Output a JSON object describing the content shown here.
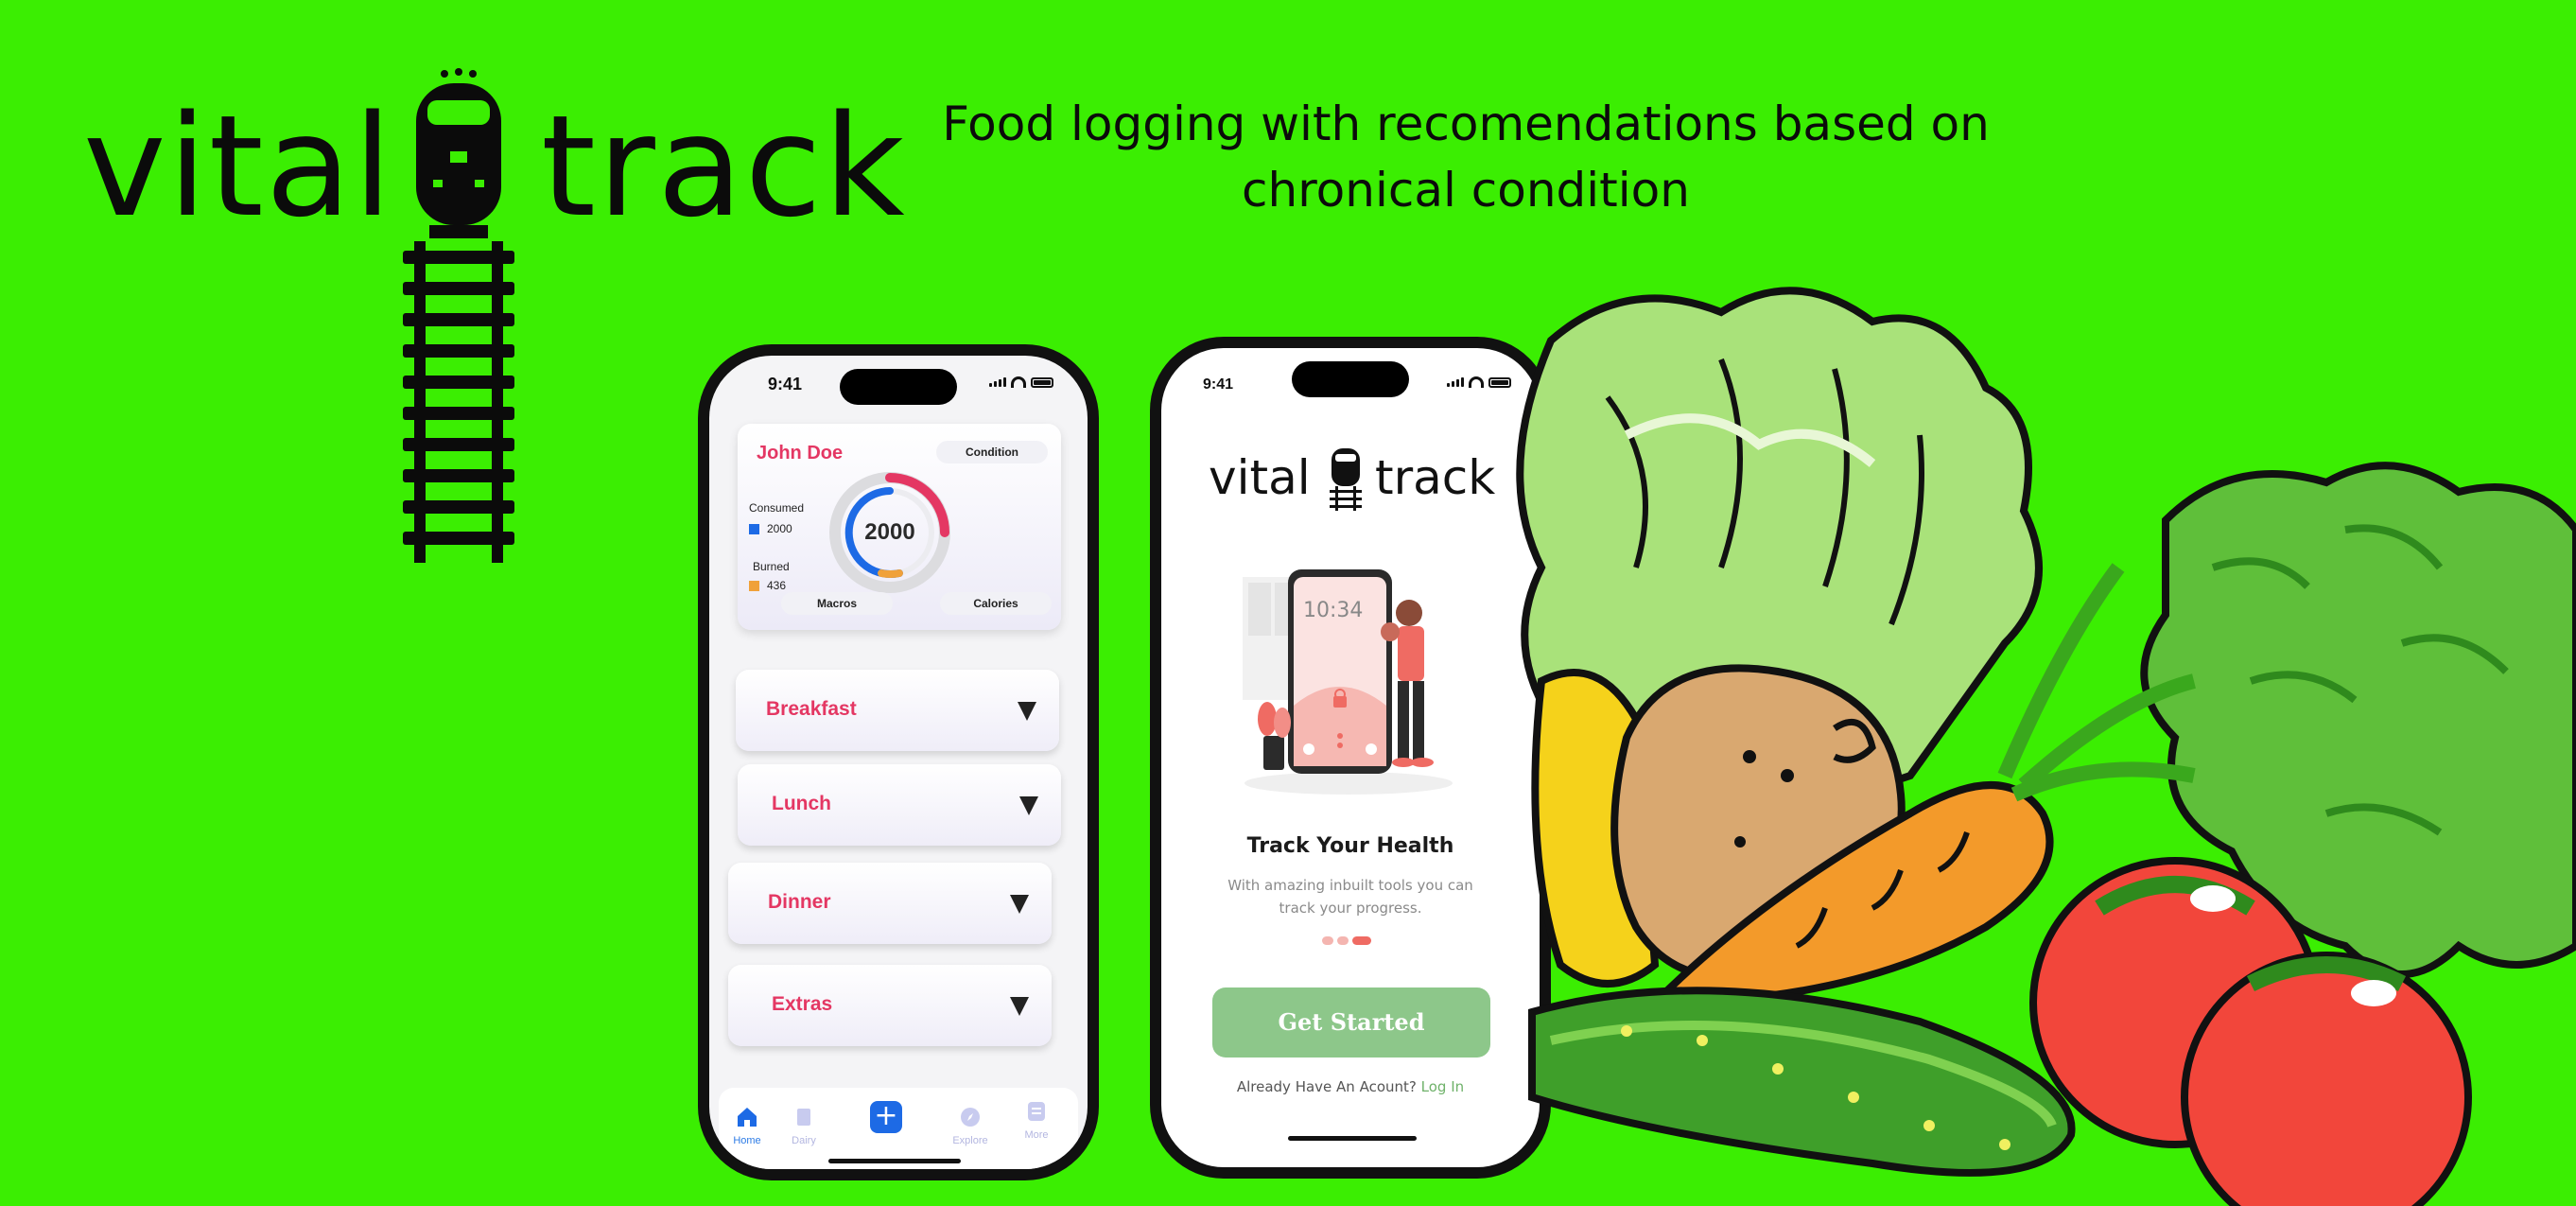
{
  "brand": {
    "word1": "vital",
    "word2": "track",
    "tagline_line1": "Food logging with recomendations based on",
    "tagline_line2": "chronical condition"
  },
  "colors": {
    "background": "#3bee02",
    "accent_pink": "#e43763",
    "accent_blue": "#1d6ae5",
    "accent_green_button": "#8dc78a",
    "link_green": "#6fb26a"
  },
  "phone_dashboard": {
    "status_time": "9:41",
    "user_name": "John Doe",
    "condition_button": "Condition",
    "consumed_label": "Consumed",
    "consumed_value": "2000",
    "burned_label": "Burned",
    "burned_value": "436",
    "ring_value": "2000",
    "macros_button": "Macros",
    "calories_button": "Calories",
    "meals": [
      {
        "label": "Breakfast"
      },
      {
        "label": "Lunch"
      },
      {
        "label": "Dinner"
      },
      {
        "label": "Extras"
      }
    ],
    "tabs": [
      {
        "label": "Home",
        "icon": "home-icon",
        "active": true
      },
      {
        "label": "Dairy",
        "icon": "book-icon",
        "active": false
      },
      {
        "label": "",
        "icon": "plus-icon",
        "active": false
      },
      {
        "label": "Explore",
        "icon": "compass-icon",
        "active": false
      },
      {
        "label": "More",
        "icon": "list-icon",
        "active": false
      }
    ]
  },
  "phone_onboarding": {
    "status_time": "9:41",
    "logo_word1": "vital",
    "logo_word2": "track",
    "illustration_clock": "10:34",
    "title": "Track Your Health",
    "subtitle": "With amazing inbuilt tools you can track your progress.",
    "cta": "Get Started",
    "login_prompt": "Already Have An Acount?",
    "login_link": "Log In"
  }
}
